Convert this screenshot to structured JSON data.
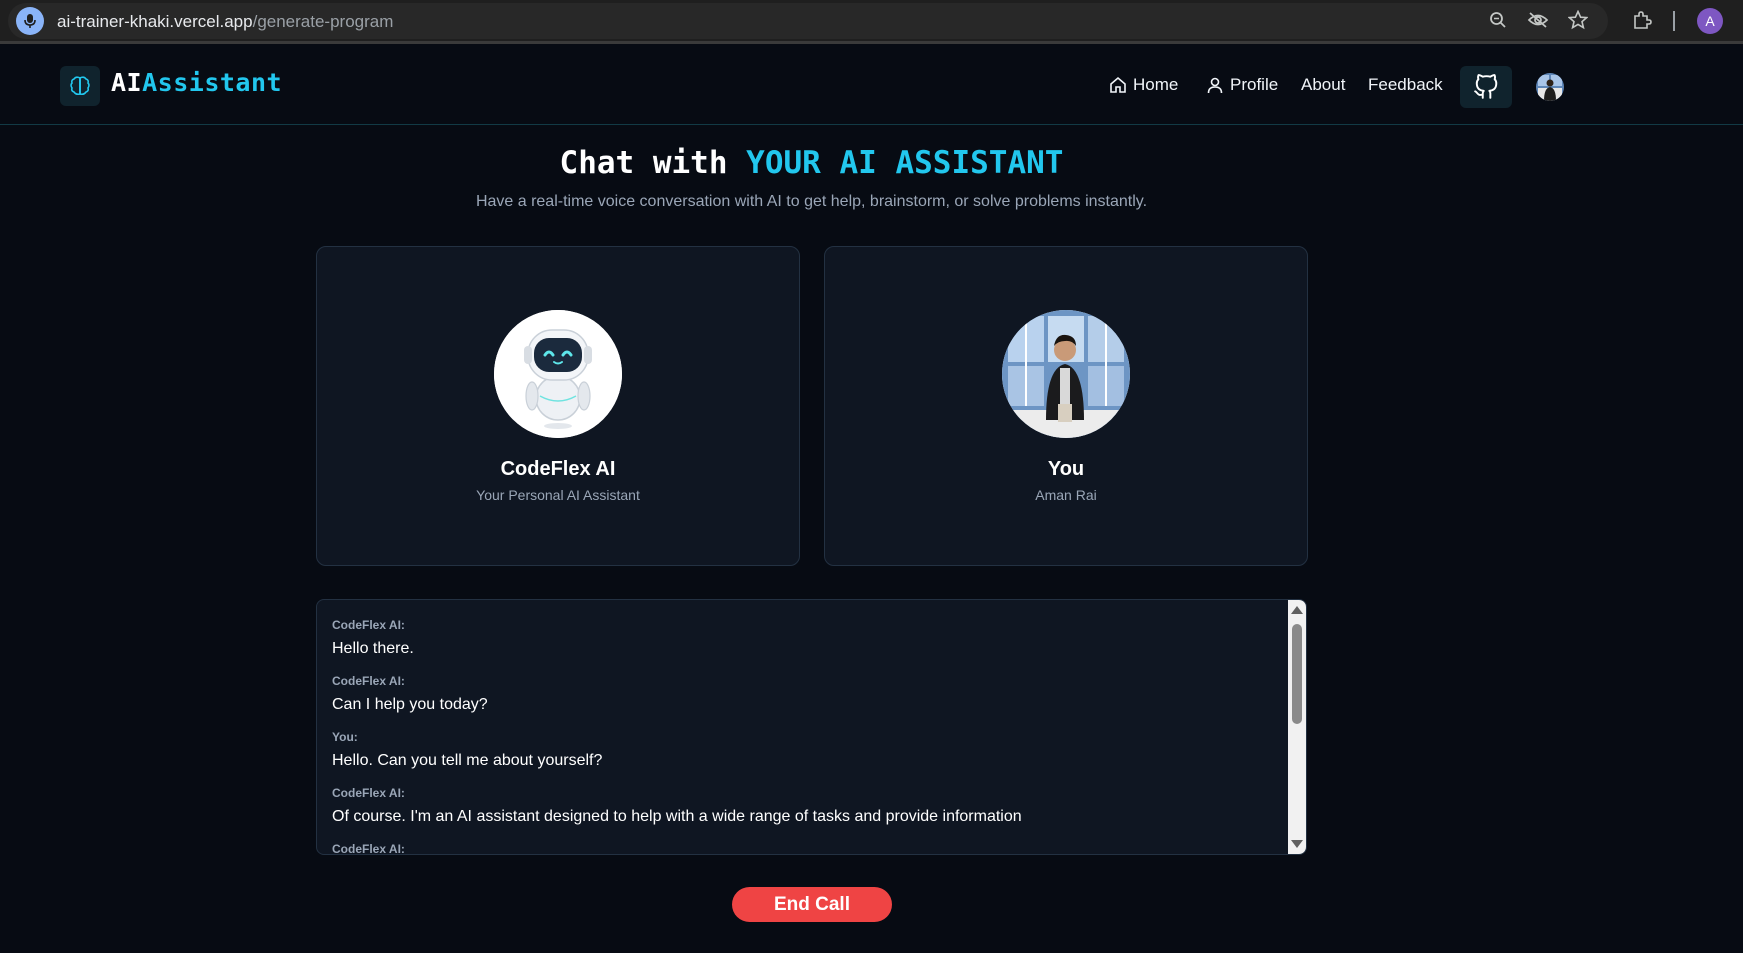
{
  "browser": {
    "url_host": "ai-trainer-khaki.vercel.app",
    "url_path": "/generate-program",
    "profile_initial": "A",
    "icons": [
      "mic-icon",
      "zoom-icon",
      "eye-off-icon",
      "star-icon",
      "extensions-icon"
    ]
  },
  "header": {
    "logo_ai": "AI",
    "logo_assistant": "Assistant",
    "logo_icon": "brain-icon",
    "nav": {
      "home": "Home",
      "profile": "Profile",
      "about": "About",
      "feedback": "Feedback"
    },
    "github_icon": "github-icon"
  },
  "main": {
    "title_part1": "Chat with ",
    "title_part2": "YOUR AI ASSISTANT",
    "subtitle": "Have a real-time voice conversation with AI to get help, brainstorm, or solve problems instantly.",
    "assistant_card": {
      "name": "CodeFlex AI",
      "subtitle": "Your Personal AI Assistant"
    },
    "user_card": {
      "name": "You",
      "subtitle": "Aman Rai"
    },
    "transcript": [
      {
        "speaker": "CodeFlex AI:",
        "text": "Hello there."
      },
      {
        "speaker": "CodeFlex AI:",
        "text": "Can I help you today?"
      },
      {
        "speaker": "You:",
        "text": "Hello. Can you tell me about yourself?"
      },
      {
        "speaker": "CodeFlex AI:",
        "text": "Of course. I'm an AI assistant designed to help with a wide range of tasks and provide information"
      },
      {
        "speaker": "CodeFlex AI:",
        "text": ""
      }
    ],
    "end_call_label": "End Call"
  },
  "colors": {
    "background": "#070b13",
    "accent": "#22c7ee",
    "card": "#0f1622",
    "danger": "#ef4444"
  }
}
